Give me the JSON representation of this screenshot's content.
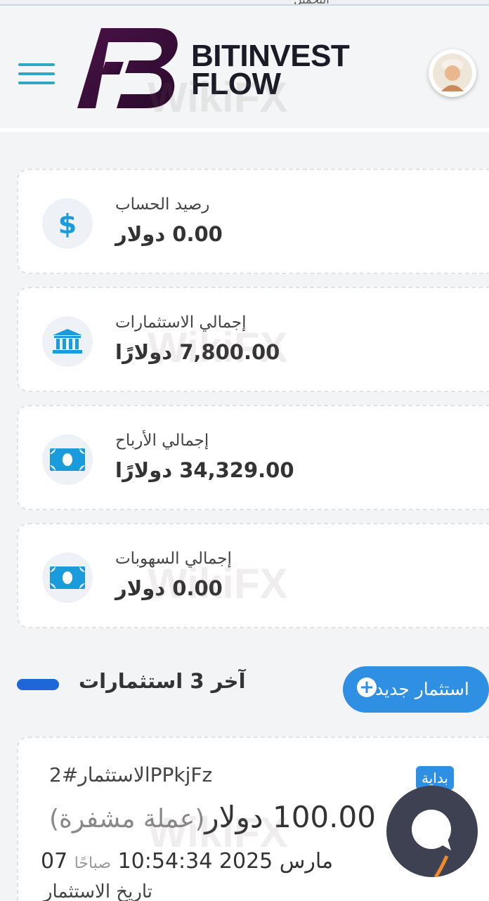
{
  "header": {
    "top_strip_text": "التحميل",
    "brand_line1": "BITINVEST",
    "brand_line2": "FLOW",
    "brand_color": "#3a0f3a"
  },
  "stats": [
    {
      "label": "رصيد الحساب",
      "value": "0.00 دولار",
      "icon": "dollar-icon"
    },
    {
      "label": "إجمالي الاستثمارات",
      "value": "7,800.00 دولارًا",
      "icon": "bank-icon"
    },
    {
      "label": "إجمالي الأرباح",
      "value": "34,329.00 دولارًا",
      "icon": "money-bill-icon"
    },
    {
      "label": "إجمالي السهوبات",
      "value": "0.00 دولار",
      "icon": "money-bill-icon"
    }
  ],
  "investments_section": {
    "title": "آخر 3 استثمارات",
    "new_button_label": "استثمار جديد"
  },
  "investment": {
    "id_text": "الاستثمار#2PPkjFz",
    "status": "بداية",
    "amount": "100.00 دولار",
    "currency_note": "(عملة مشفرة)",
    "date_main": "07 مارس 2025 10:54:34",
    "date_suffix": "صباحًا",
    "date_label": "تاريخ الاستثمار"
  },
  "watermark_text": "WikiFX",
  "colors": {
    "accent": "#2f8fe2",
    "icon_blue": "#1a9bdc",
    "section_bar": "#1d67d8",
    "chat_bg": "#3e4151"
  }
}
